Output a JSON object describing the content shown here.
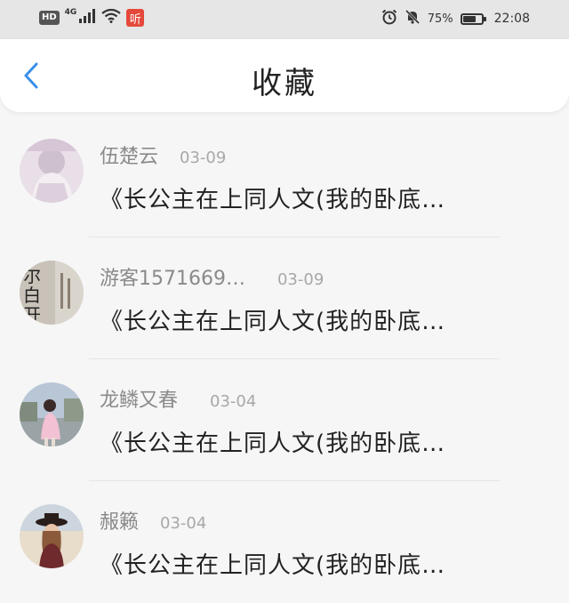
{
  "status_bar": {
    "hd_label": "HD",
    "network_label": "4G",
    "listen_label": "听",
    "battery_percent": "75%",
    "battery_level": 0.75,
    "time": "22:08",
    "icons": [
      "signal-icon",
      "wifi-icon",
      "alarm-icon",
      "mute-icon",
      "battery-icon"
    ]
  },
  "header": {
    "title": "收藏",
    "back_icon": "chevron-left-icon",
    "accent_color": "#3a8fe8"
  },
  "favorites": [
    {
      "name": "伍楚云",
      "date": "03-09",
      "snippet": "《长公主在上同人文(我的卧底…"
    },
    {
      "name": "游客1571669…",
      "date": "03-09",
      "snippet": "《长公主在上同人文(我的卧底…"
    },
    {
      "name": "龙鳞又春",
      "date": "03-04",
      "snippet": "《长公主在上同人文(我的卧底…"
    },
    {
      "name": "赧籁",
      "date": "03-04",
      "snippet": "《长公主在上同人文(我的卧底…"
    }
  ]
}
